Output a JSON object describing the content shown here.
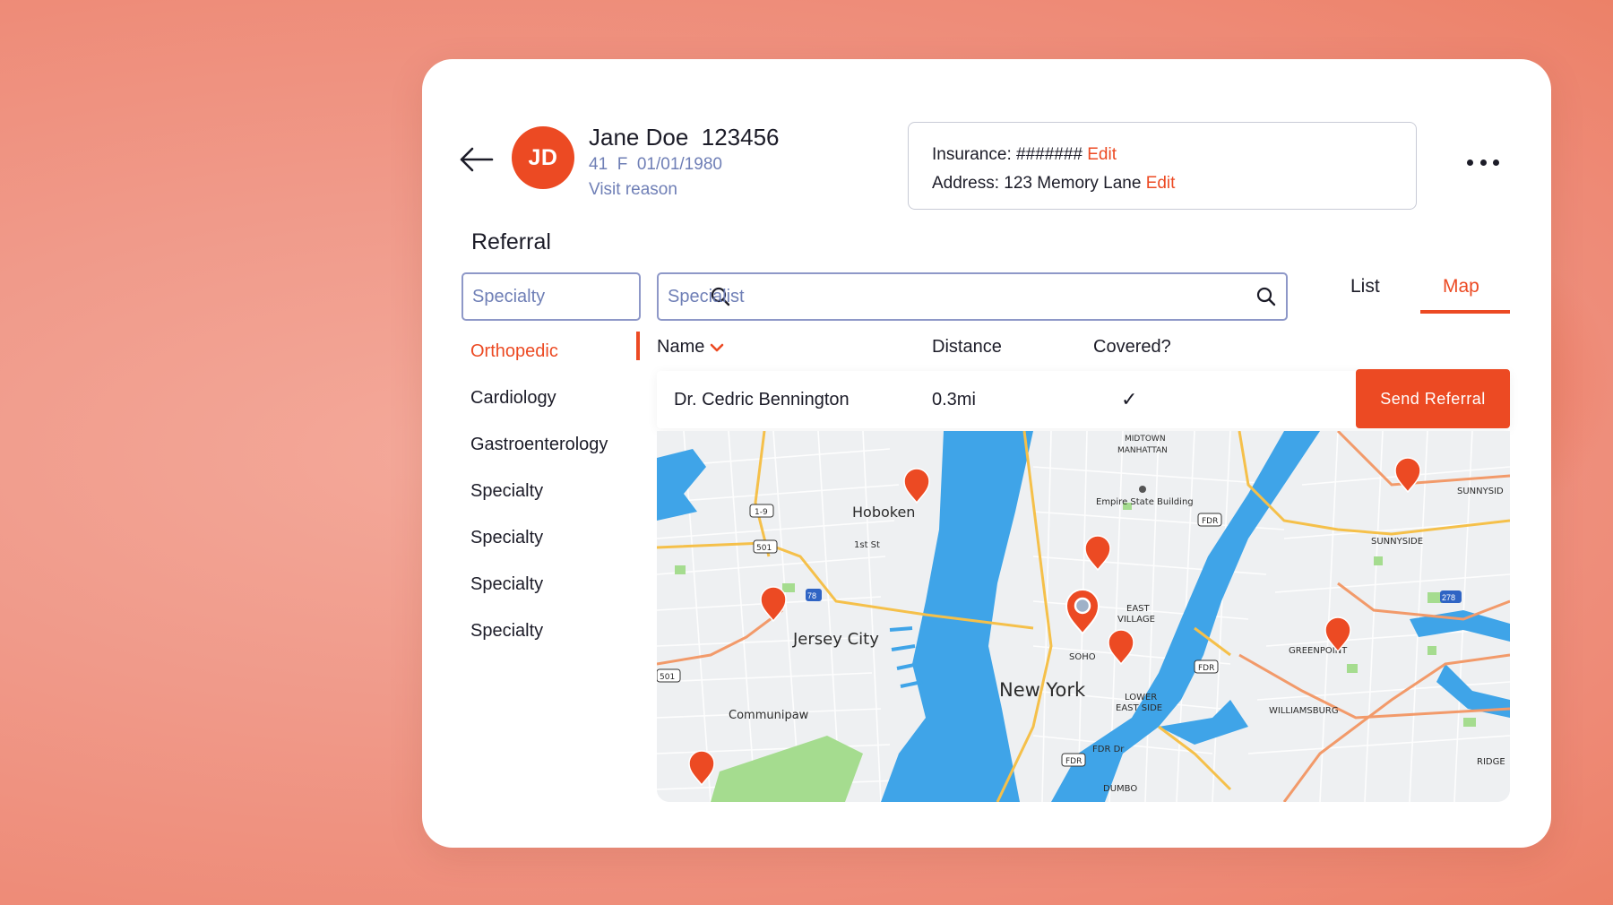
{
  "patient": {
    "initials": "JD",
    "name": "Jane Doe  123456",
    "meta": "41  F  01/01/1980",
    "visit_reason": "Visit reason"
  },
  "info": {
    "insurance_label": "Insurance: ####### ",
    "address_label": "Address: 123 Memory Lane ",
    "edit": "Edit"
  },
  "section_title": "Referral",
  "search": {
    "specialty_placeholder": "Specialty",
    "specialist_placeholder": "Specialist"
  },
  "tabs": {
    "list": "List",
    "map": "Map"
  },
  "specialties": [
    "Orthopedic",
    "Cardiology",
    "Gastroenterology",
    "Specialty",
    "Specialty",
    "Specialty",
    "Specialty"
  ],
  "table": {
    "headers": {
      "name": "Name",
      "distance": "Distance",
      "covered": "Covered?"
    },
    "row": {
      "name": "Dr. Cedric Bennington",
      "distance": "0.3mi",
      "covered": "✓"
    },
    "send_button": "Send Referral"
  },
  "map_labels": {
    "hoboken": "Hoboken",
    "jersey_city": "Jersey City",
    "new_york": "New York",
    "communipaw": "Communipaw",
    "midtown": "MIDTOWN",
    "manhattan": "MANHATTAN",
    "empire": "Empire State Building",
    "east": "EAST",
    "village": "VILLAGE",
    "soho": "SOHO",
    "lower": "LOWER",
    "east_side": "EAST SIDE",
    "sunnyside": "SUNNYSIDE",
    "sunnysid_edge": "SUNNYSID",
    "greenpoint": "GREENPOINT",
    "williamsburg": "WILLIAMSBURG",
    "dumbo": "DUMBO",
    "ridge": "RIDGE",
    "first_st": "1st St",
    "fdr": "FDR",
    "fdr_dr": "FDR Dr",
    "r501": "501",
    "r19": "1-9",
    "r78": "78",
    "r278": "278"
  },
  "colors": {
    "accent": "#ec4a23",
    "muted_text": "#6f7fb6",
    "water": "#3fa4e8",
    "park": "#a5dc8f"
  }
}
